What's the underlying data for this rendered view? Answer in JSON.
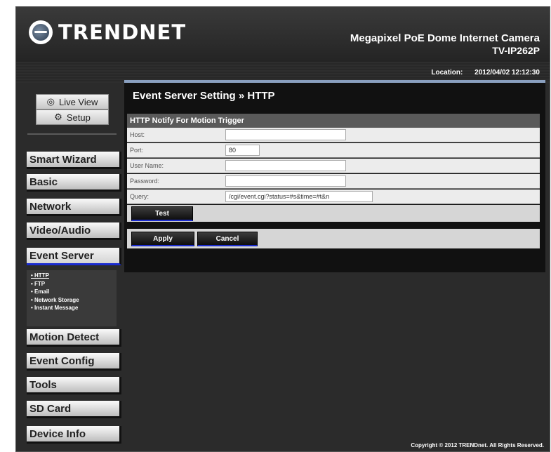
{
  "header": {
    "logo_text": "TRENDNET",
    "product_name": "Megapixel PoE Dome Internet Camera",
    "model": "TV-IP262P"
  },
  "topbar": {
    "location_label": "Location:",
    "datetime": "2012/04/02 12:12:30"
  },
  "modes": {
    "live_view": "Live View",
    "setup": "Setup"
  },
  "nav": {
    "items": [
      {
        "label": "Smart Wizard"
      },
      {
        "label": "Basic"
      },
      {
        "label": "Network"
      },
      {
        "label": "Video/Audio"
      },
      {
        "label": "Event Server"
      },
      {
        "label": "Motion Detect"
      },
      {
        "label": "Event Config"
      },
      {
        "label": "Tools"
      },
      {
        "label": "SD Card"
      },
      {
        "label": "Device Info"
      }
    ],
    "submenu": [
      "• HTTP",
      "• FTP",
      "• Email",
      "• Network Storage",
      "• Instant Message"
    ]
  },
  "main": {
    "title": "Event Server Setting » HTTP",
    "section": "HTTP Notify For Motion Trigger",
    "fields": {
      "host_label": "Host:",
      "host_value": "",
      "port_label": "Port:",
      "port_value": "80",
      "user_label": "User Name:",
      "user_value": "",
      "pass_label": "Password:",
      "pass_value": "",
      "query_label": "Query:",
      "query_value": "/cgi/event.cgi?status=#s&time=#t&n"
    },
    "test_label": "Test",
    "apply_label": "Apply",
    "cancel_label": "Cancel"
  },
  "footer": {
    "copyright": "Copyright © 2012 TRENDnet. All Rights Reserved."
  },
  "colors": {
    "accent_blue": "#1a2bd0",
    "panel_top": "#8aa0c0"
  }
}
